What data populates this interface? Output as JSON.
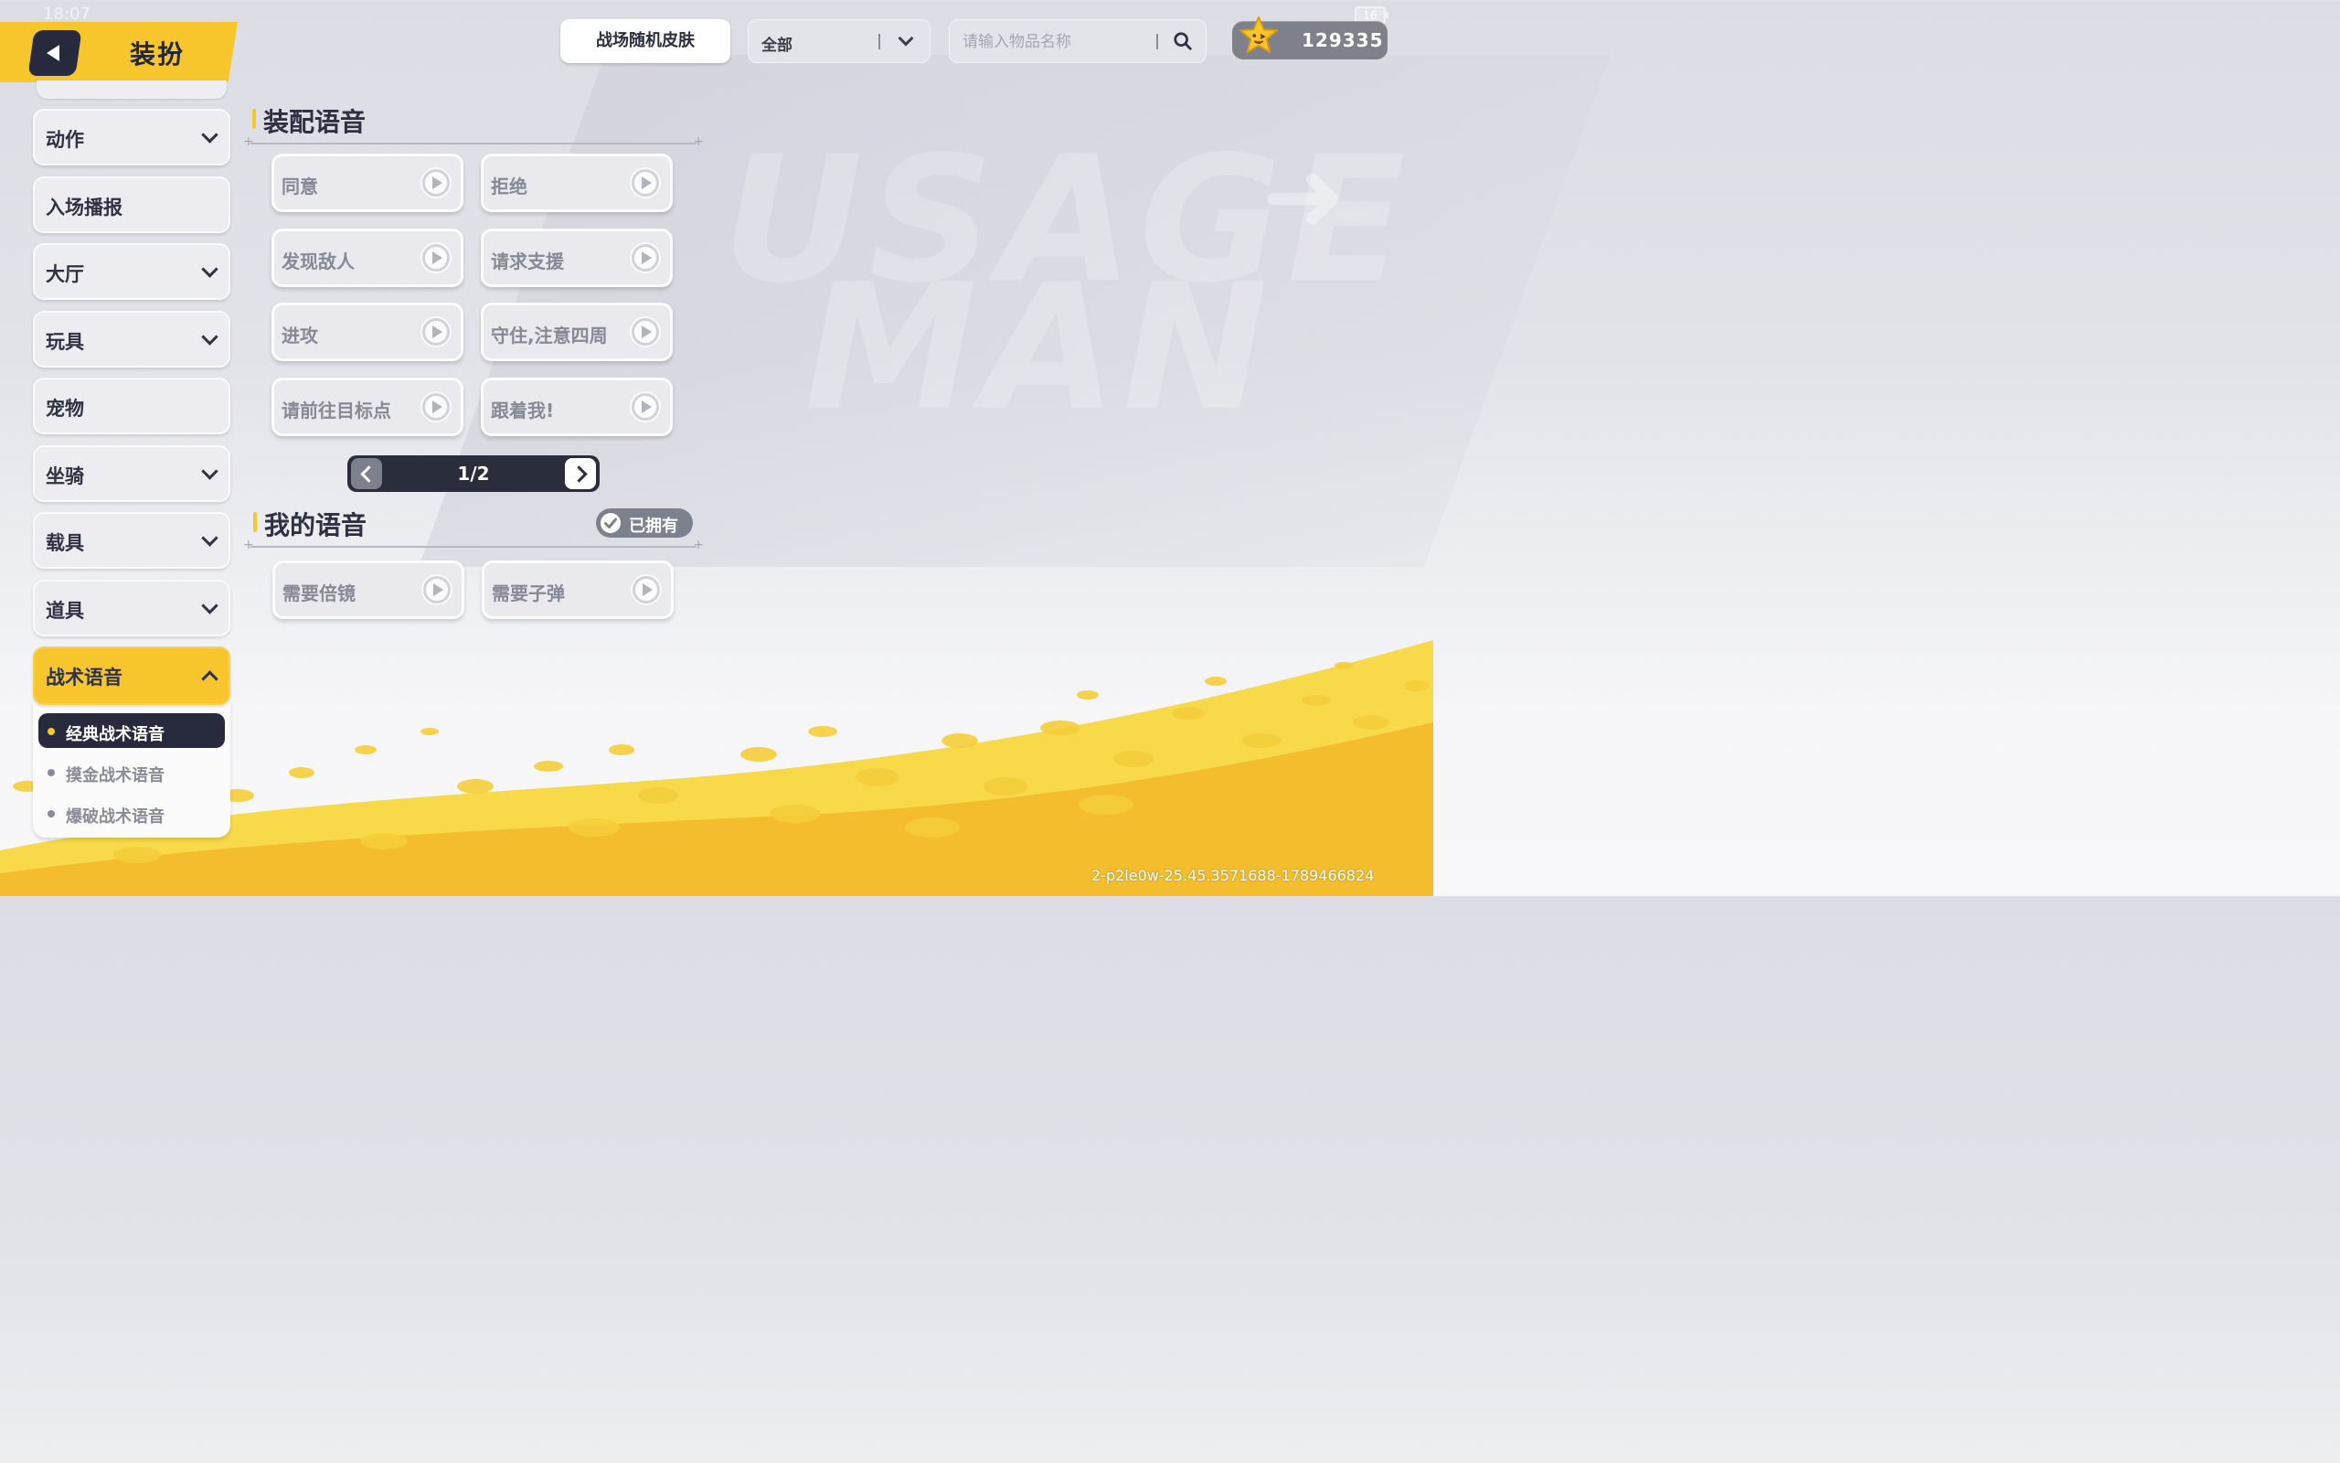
{
  "status_bar": {
    "time": "18:07",
    "battery": "16"
  },
  "background": {
    "words": [
      "USAGE",
      "MAN"
    ]
  },
  "header": {
    "title": "装扮"
  },
  "toolbar": {
    "random_skin_label": "战场随机皮肤",
    "filter_value": "全部",
    "search_placeholder": "请输入物品名称",
    "currency_amount": "129335"
  },
  "sidebar": {
    "items": [
      {
        "label": "动作",
        "has_chevron": true
      },
      {
        "label": "入场播报",
        "has_chevron": false
      },
      {
        "label": "大厅",
        "has_chevron": true
      },
      {
        "label": "玩具",
        "has_chevron": true
      },
      {
        "label": "宠物",
        "has_chevron": false
      },
      {
        "label": "坐骑",
        "has_chevron": true
      },
      {
        "label": "载具",
        "has_chevron": true
      },
      {
        "label": "道具",
        "has_chevron": true
      },
      {
        "label": "战术语音",
        "has_chevron": true,
        "expanded": true
      }
    ],
    "sub_items": [
      {
        "label": "经典战术语音",
        "selected": true
      },
      {
        "label": "摸金战术语音",
        "selected": false
      },
      {
        "label": "爆破战术语音",
        "selected": false
      }
    ]
  },
  "equipped": {
    "title": "装配语音",
    "voices": [
      "同意",
      "拒绝",
      "发现敌人",
      "请求支援",
      "进攻",
      "守住,注意四周",
      "请前往目标点",
      "跟着我!"
    ],
    "pager": "1/2"
  },
  "mine": {
    "title": "我的语音",
    "owned_label": "已拥有",
    "voices": [
      "需要倍镜",
      "需要子弹"
    ]
  },
  "footer_id": "2-p2le0w-25.45.3571688-1789466824",
  "colors": {
    "accent": "#f6c62c",
    "dark": "#262a3c"
  }
}
